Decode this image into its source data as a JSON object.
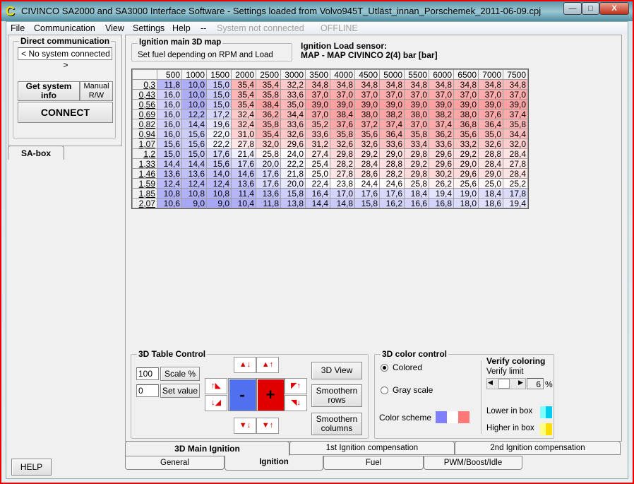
{
  "window": {
    "title": "CIVINCO SA2000 and SA3000 Interface Software - Settings loaded from Volvo945T_Utläst_innan_Porschemek_2011-06-09.cpj",
    "minimize": "—",
    "maximize": "□",
    "close": "X"
  },
  "menu": {
    "items": [
      "File",
      "Communication",
      "View",
      "Settings",
      "Help"
    ],
    "separator": "--",
    "status": "System not connected",
    "mode": "OFFLINE"
  },
  "left": {
    "group_title": "Direct communication",
    "system_field": "< No system connected >",
    "get_info": "Get system info",
    "manual": "Manual R/W",
    "connect": "CONNECT",
    "tab": "SA-box",
    "help": "HELP"
  },
  "map": {
    "group_title": "Ignition main 3D map",
    "description": "Set fuel depending on RPM and Load",
    "sensor_label": "Ignition Load sensor:",
    "sensor_value": "MAP - MAP CIVINCO 2(4) bar [bar]",
    "columns": [
      "500",
      "1000",
      "1500",
      "2000",
      "2500",
      "3000",
      "3500",
      "4000",
      "4500",
      "5000",
      "5500",
      "6000",
      "6500",
      "7000",
      "7500"
    ],
    "rows": [
      {
        "load": "0,3",
        "values": [
          "11,8",
          "10,0",
          "15,0",
          "35,4",
          "35,4",
          "32,2",
          "34,8",
          "34,8",
          "34,8",
          "34,8",
          "34,8",
          "34,8",
          "34,8",
          "34,8",
          "34,8"
        ]
      },
      {
        "load": "0,43",
        "values": [
          "16,0",
          "10,0",
          "15,0",
          "35,4",
          "35,8",
          "33,6",
          "37,0",
          "37,0",
          "37,0",
          "37,0",
          "37,0",
          "37,0",
          "37,0",
          "37,0",
          "37,0"
        ]
      },
      {
        "load": "0,56",
        "values": [
          "16,0",
          "10,0",
          "15,0",
          "35,4",
          "38,4",
          "35,0",
          "39,0",
          "39,0",
          "39,0",
          "39,0",
          "39,0",
          "39,0",
          "39,0",
          "39,0",
          "39,0"
        ]
      },
      {
        "load": "0,69",
        "values": [
          "16,0",
          "12,2",
          "17,2",
          "32,4",
          "36,2",
          "34,4",
          "37,0",
          "38,4",
          "38,0",
          "38,2",
          "38,0",
          "38,2",
          "38,0",
          "37,6",
          "37,4"
        ]
      },
      {
        "load": "0,82",
        "values": [
          "16,0",
          "14,4",
          "19,6",
          "32,4",
          "35,8",
          "33,6",
          "35,2",
          "37,6",
          "37,2",
          "37,4",
          "37,0",
          "37,4",
          "36,8",
          "36,4",
          "35,8"
        ]
      },
      {
        "load": "0,94",
        "values": [
          "16,0",
          "15,6",
          "22,0",
          "31,0",
          "35,4",
          "32,6",
          "33,6",
          "35,8",
          "35,6",
          "36,4",
          "35,8",
          "36,2",
          "35,6",
          "35,0",
          "34,4"
        ]
      },
      {
        "load": "1,07",
        "values": [
          "15,6",
          "15,6",
          "22,2",
          "27,8",
          "32,0",
          "29,6",
          "31,2",
          "32,6",
          "32,6",
          "33,6",
          "33,4",
          "33,6",
          "33,2",
          "32,6",
          "32,0"
        ]
      },
      {
        "load": "1,2",
        "values": [
          "15,0",
          "15,0",
          "17,6",
          "21,4",
          "25,8",
          "24,0",
          "27,4",
          "29,8",
          "29,2",
          "29,0",
          "29,8",
          "29,6",
          "29,2",
          "28,8",
          "28,4"
        ]
      },
      {
        "load": "1,33",
        "values": [
          "14,4",
          "14,4",
          "15,6",
          "17,6",
          "20,0",
          "22,2",
          "25,4",
          "28,2",
          "28,4",
          "28,8",
          "29,2",
          "29,6",
          "29,0",
          "28,4",
          "27,8"
        ]
      },
      {
        "load": "1,46",
        "values": [
          "13,6",
          "13,6",
          "14,0",
          "14,6",
          "17,6",
          "21,8",
          "25,0",
          "27,8",
          "28,6",
          "28,2",
          "29,8",
          "30,2",
          "29,6",
          "29,0",
          "28,4"
        ]
      },
      {
        "load": "1,59",
        "values": [
          "12,4",
          "12,4",
          "12,4",
          "13,6",
          "17,6",
          "20,0",
          "22,4",
          "23,8",
          "24,4",
          "24,6",
          "25,8",
          "26,2",
          "25,6",
          "25,0",
          "25,2"
        ]
      },
      {
        "load": "1,85",
        "values": [
          "10,8",
          "10,8",
          "10,8",
          "11,4",
          "13,6",
          "15,8",
          "16,4",
          "17,0",
          "17,6",
          "17,6",
          "18,4",
          "19,4",
          "19,0",
          "18,4",
          "17,8"
        ]
      },
      {
        "load": "2,07",
        "values": [
          "10,6",
          "9,0",
          "9,0",
          "10,4",
          "11,8",
          "13,8",
          "14,4",
          "14,8",
          "15,8",
          "16,2",
          "16,6",
          "16,8",
          "18,0",
          "18,6",
          "19,4"
        ]
      }
    ]
  },
  "table_control": {
    "title": "3D Table Control",
    "scale_value": "100",
    "scale_label": "Scale %",
    "set_value": "0",
    "set_label": "Set value",
    "minus": "-",
    "plus": "+",
    "view3d": "3D View",
    "smooth_rows": "Smoothern rows",
    "smooth_cols": "Smoothern columns"
  },
  "color_control": {
    "title": "3D color control",
    "colored": "Colored",
    "gray": "Gray scale",
    "selected": "Colored",
    "scheme_label": "Color scheme",
    "scheme_colors": [
      "#8080ff",
      "#ffffff",
      "#ff7878"
    ],
    "verify_title": "Verify coloring",
    "verify_limit_label": "Verify limit",
    "verify_limit": "6",
    "percent": "%",
    "lower": "Lower in box",
    "higher": "Higher in box",
    "lower_colors": [
      "#80ffff",
      "#00ccf0"
    ],
    "higher_colors": [
      "#ffff80",
      "#ffdd00"
    ]
  },
  "subtabs": [
    "3D Main Ignition",
    "1st Ignition compensation",
    "2nd Ignition compensation"
  ],
  "maintabs": [
    "General",
    "Ignition",
    "Fuel",
    "PWM/Boost/Idle"
  ],
  "selected_subtab": "3D Main Ignition",
  "selected_maintab": "Ignition"
}
